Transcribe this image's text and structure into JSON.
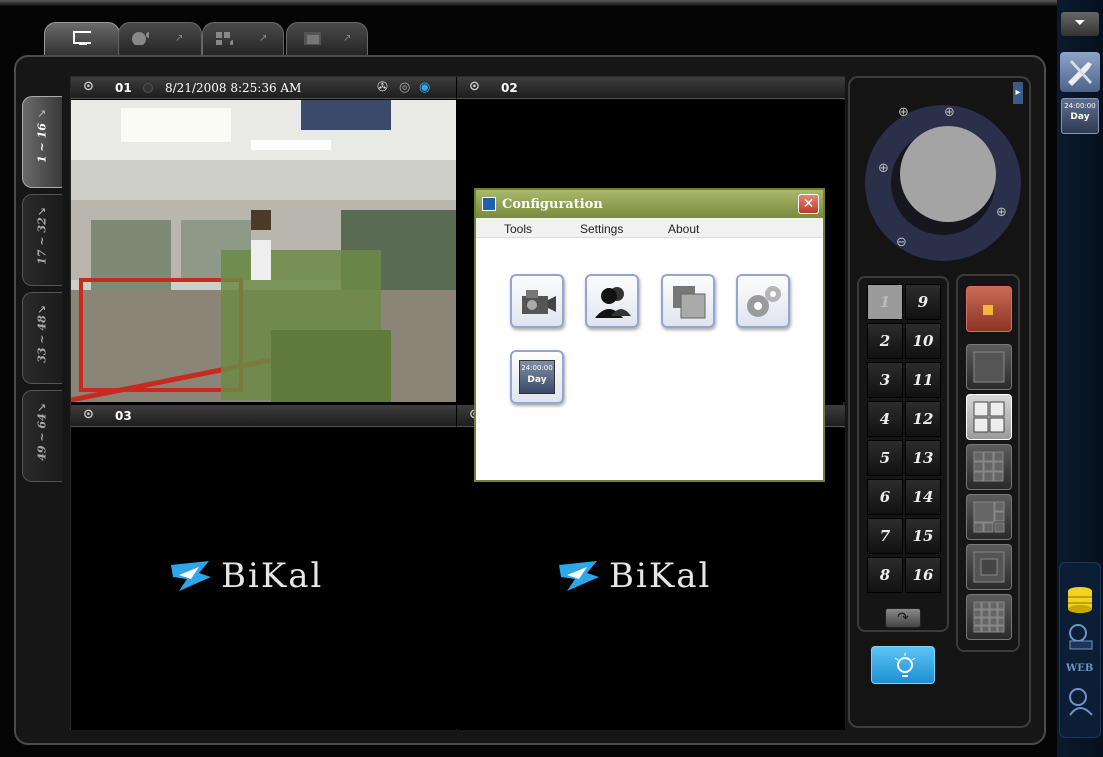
{
  "top_tabs": [
    {
      "icon": "monitor-icon",
      "active": true
    },
    {
      "icon": "ptz-camera-icon",
      "active": false
    },
    {
      "icon": "playback-grid-icon",
      "active": false
    },
    {
      "icon": "image-icon",
      "active": false
    }
  ],
  "side_tabs": [
    {
      "label": "1 ~ 16",
      "active": true
    },
    {
      "label": "17 ~ 32",
      "active": false
    },
    {
      "label": "33 ~ 48",
      "active": false
    },
    {
      "label": "49 ~ 64",
      "active": false
    }
  ],
  "cameras": [
    {
      "num": "01",
      "datetime": "8/21/2008 8:25:36 AM"
    },
    {
      "num": "02",
      "datetime": ""
    },
    {
      "num": "03",
      "datetime": ""
    },
    {
      "num": "",
      "datetime": ""
    }
  ],
  "logo_text": "BiKal",
  "dialog": {
    "title": "Configuration",
    "close_label": "✕",
    "menu": [
      "Tools",
      "Settings",
      "About"
    ],
    "buttons": [
      "camera-settings-icon",
      "users-icon",
      "layout-icon",
      "gears-icon",
      "schedule-day-icon"
    ],
    "schedule_time": "24:00:00",
    "schedule_day": "Day"
  },
  "channels_left": [
    "1",
    "2",
    "3",
    "4",
    "5",
    "6",
    "7",
    "8"
  ],
  "channels_right": [
    "9",
    "10",
    "11",
    "12",
    "13",
    "14",
    "15",
    "16"
  ],
  "selected_channel": "1",
  "right_bar": {
    "schedule_time": "24:00:00",
    "schedule_day": "Day",
    "web_label": "WEB"
  },
  "colors": {
    "accent_blue": "#2ea6ea",
    "record_red": "#b8483b",
    "dialog_green": "#788a3d"
  }
}
